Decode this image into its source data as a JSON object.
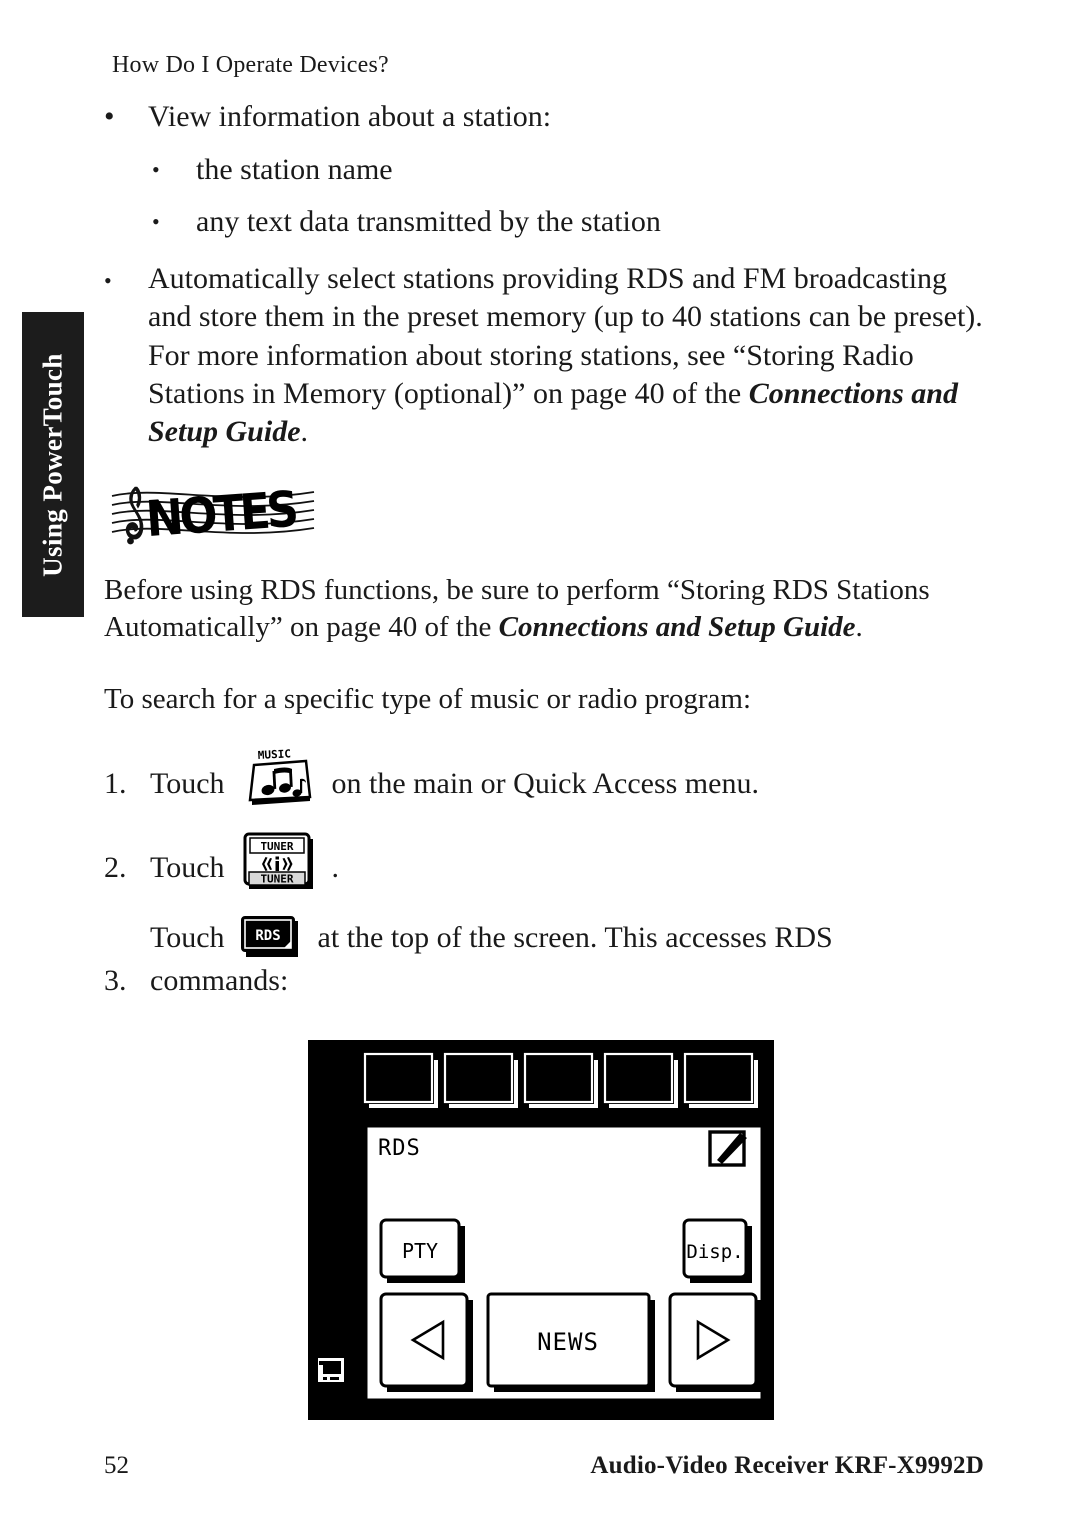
{
  "running_head": "How Do I Operate Devices?",
  "side_tab": {
    "label": "Using PowerTouch"
  },
  "bullets": [
    {
      "marker": "•",
      "level": 1,
      "text": "View information about a station:"
    },
    {
      "marker": "•",
      "level": 2,
      "text": "the station name"
    },
    {
      "marker": "•",
      "level": 2,
      "text": "any text data transmitted by the station"
    }
  ],
  "rds_bullet": {
    "marker": "•",
    "text_before": "Automatically select stations providing RDS and FM broadcasting and store them in the preset memory (up to 40 stations can be preset). For more information about storing stations, see “Storing Radio Stations in Memory (optional)” on page 40 of the ",
    "italic_ref": "Connections and Setup Guide",
    "text_after": "."
  },
  "notes": {
    "logo_label": "NOTES",
    "para_before": "Before using RDS functions, be sure to perform “Storing RDS Stations Automatically” on page 40 of the ",
    "italic_ref": "Connections and Setup Guide",
    "para_after": "."
  },
  "intro": "To search for a specific type of music or radio program:",
  "steps": [
    {
      "number": "1.",
      "verb": "Touch ",
      "icon": "music-tile-icon",
      "icon_label": "MUSIC",
      "after": " on the main or Quick Access menu.",
      "continuation": ""
    },
    {
      "number": "2.",
      "verb": "Touch ",
      "icon": "tuner-tile-icon",
      "icon_label": "TUNER",
      "icon_label_bottom": "TUNER",
      "after": " .",
      "continuation": ""
    },
    {
      "number": "3.",
      "verb": "Touch ",
      "icon": "rds-tile-icon",
      "icon_label": "RDS",
      "after": " at the top of the screen. This accesses RDS",
      "continuation": "commands:"
    }
  ],
  "device_screen": {
    "title": "RDS",
    "edit_icon": "pencil-edit-icon",
    "status_icon": "display-monitor-icon",
    "tab_count": 5,
    "tabs": [
      "",
      "",
      "",
      "",
      ""
    ],
    "buttons": [
      {
        "name": "pty-button",
        "label": "PTY"
      },
      {
        "name": "disp-button",
        "label": "Disp."
      },
      {
        "name": "prev-button",
        "label": "◁"
      },
      {
        "name": "news-button",
        "label": "NEWS"
      },
      {
        "name": "next-button",
        "label": "▷"
      }
    ]
  },
  "footer": {
    "page_number": "52",
    "product": "Audio-Video Receiver KRF-X9992D"
  },
  "colors": {
    "ink": "#1a1a1a",
    "tab_bg": "#1c1c1c",
    "tab_text": "#ffffff",
    "lcd_bg": "#ffffff",
    "lcd_frame": "#000000"
  }
}
